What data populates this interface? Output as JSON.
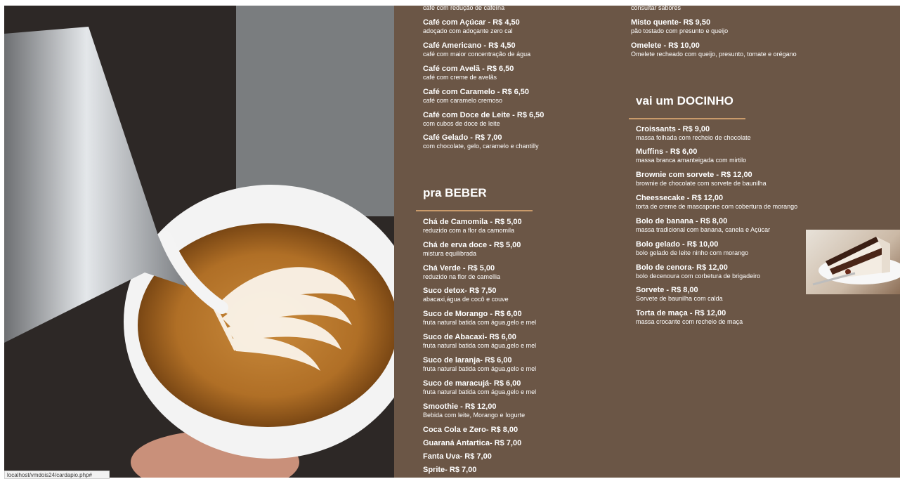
{
  "colors": {
    "panel": "#6b5646",
    "accent": "#c99a6a"
  },
  "cafes": [
    {
      "name": "",
      "desc": "café com redução de cafeína"
    },
    {
      "name": "Café com Açúcar - R$ 4,50",
      "desc": "adoçado com adoçante zero cal"
    },
    {
      "name": "Café Americano - R$ 4,50",
      "desc": "café com maior concentração de água"
    },
    {
      "name": "Café com Avelã - R$ 6,50",
      "desc": "café com creme de avelãs"
    },
    {
      "name": "Café com Caramelo - R$ 6,50",
      "desc": "café com caramelo cremoso"
    },
    {
      "name": "Café com Doce de Leite - R$ 6,50",
      "desc": "com cubos de doce de leite"
    },
    {
      "name": "Café Gelado - R$ 7,00",
      "desc": "com chocolate, gelo, caramelo e chantilly"
    }
  ],
  "beber": {
    "title": "pra BEBER",
    "items": [
      {
        "name": "Chá de Camomila - R$ 5,00",
        "desc": "reduzido com a flor da camomila"
      },
      {
        "name": "Chá de erva doce - R$ 5,00",
        "desc": "mistura equilibrada"
      },
      {
        "name": "Chá Verde - R$ 5,00",
        "desc": "reduzido na flor de camellia"
      },
      {
        "name": "Suco detox- R$ 7,50",
        "desc": "abacaxi,água de cocô e couve"
      },
      {
        "name": "Suco de Morango - R$ 6,00",
        "desc": "fruta natural batida com água,gelo e mel"
      },
      {
        "name": "Suco de Abacaxi- R$ 6,00",
        "desc": "fruta natural batida com água,gelo e mel"
      },
      {
        "name": "Suco de laranja- R$ 6,00",
        "desc": "fruta natural batida com água,gelo e mel"
      },
      {
        "name": "Suco de maracujá- R$ 6,00",
        "desc": "fruta natural batida com água,gelo e mel"
      },
      {
        "name": "Smoothie - R$ 12,00",
        "desc": "Bebida com leite, Morango e Iogurte"
      },
      {
        "name": "Coca Cola e Zero- R$ 8,00",
        "desc": ""
      },
      {
        "name": "Guaraná Antartica- R$ 7,00",
        "desc": ""
      },
      {
        "name": "Fanta Uva- R$ 7,00",
        "desc": ""
      },
      {
        "name": "Sprite- R$ 7,00",
        "desc": ""
      }
    ]
  },
  "salgados": [
    {
      "name": "",
      "desc": "consultar sabores"
    },
    {
      "name": "Misto quente- R$ 9,50",
      "desc": "pão tostado com presunto e queijo"
    },
    {
      "name": "Omelete - R$ 10,00",
      "desc": "Omelete recheado com queijo, presunto, tomate e orégano"
    }
  ],
  "docinho": {
    "title": "vai um DOCINHO",
    "items": [
      {
        "name": "Croissants - R$ 9,00",
        "desc": "massa folhada com recheio de chocolate"
      },
      {
        "name": "Muffins - R$ 6,00",
        "desc": "massa branca amanteigada com mirtilo"
      },
      {
        "name": "Brownie com sorvete - R$ 12,00",
        "desc": "brownie de chocolate com sorvete de baunilha"
      },
      {
        "name": "Cheessecake - R$ 12,00",
        "desc": "torta de creme de mascapone com cobertura de morango"
      },
      {
        "name": "Bolo de banana - R$ 8,00",
        "desc": "massa tradicional com banana, canela e Açúcar"
      },
      {
        "name": "Bolo gelado - R$ 10,00",
        "desc": "bolo gelado de leite ninho com morango"
      },
      {
        "name": "Bolo de cenora- R$ 12,00",
        "desc": "bolo decenoura com corbetura de brigadeiro"
      },
      {
        "name": "Sorvete - R$ 8,00",
        "desc": "Sorvete de baunilha com calda"
      },
      {
        "name": "Torta de maça - R$ 12,00",
        "desc": "massa crocante com recheio de maça"
      }
    ]
  },
  "status_url": "localhost/vmdois24/cardapio.php#"
}
